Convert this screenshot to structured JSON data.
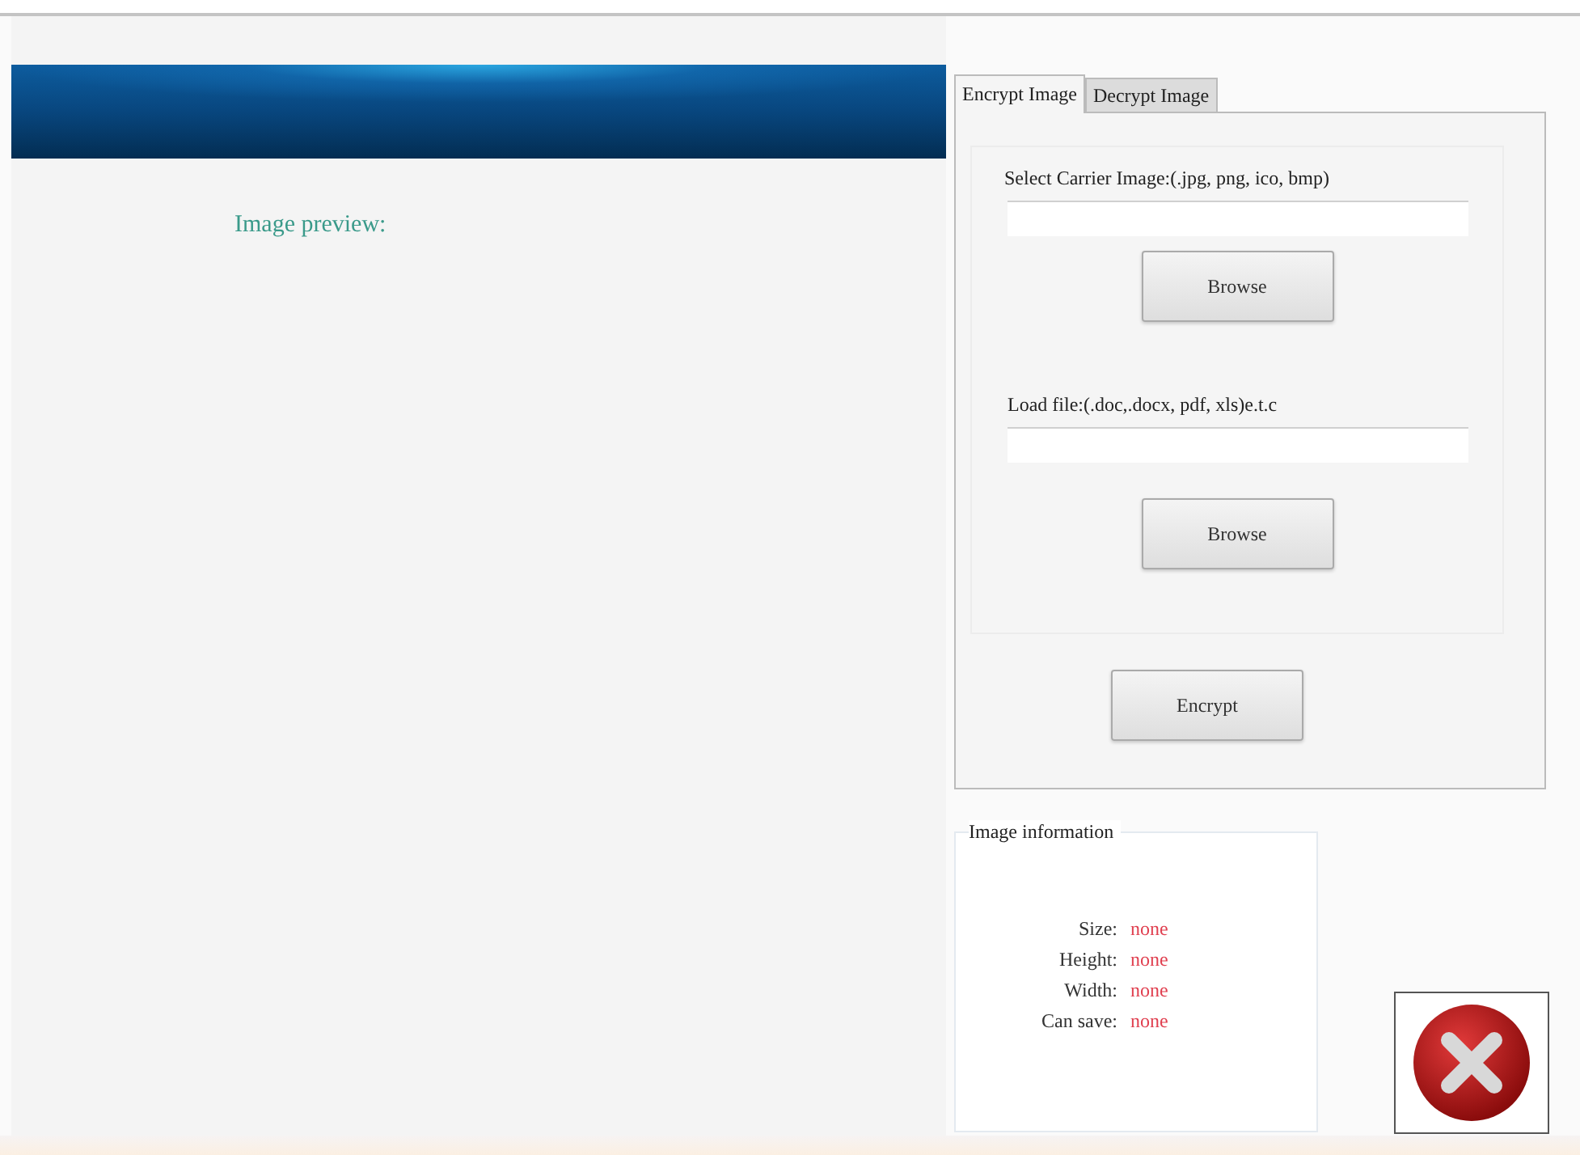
{
  "preview": {
    "label": "Image preview:"
  },
  "tabs": [
    {
      "label": "Encrypt Image",
      "selected": true
    },
    {
      "label": "Decrypt Image",
      "selected": false
    }
  ],
  "encrypt": {
    "carrier_label": "Select Carrier Image:(.jpg, png, ico, bmp)",
    "carrier_browse": "Browse",
    "file_label": "Load file:(.doc,.docx, pdf, xls)e.t.c",
    "file_browse": "Browse",
    "encrypt_button": "Encrypt"
  },
  "image_information": {
    "title": "Image information",
    "rows": [
      {
        "label": "Size:",
        "value": "none"
      },
      {
        "label": "Height:",
        "value": "none"
      },
      {
        "label": "Width:",
        "value": "none"
      },
      {
        "label": "Can save:",
        "value": "none"
      }
    ]
  }
}
